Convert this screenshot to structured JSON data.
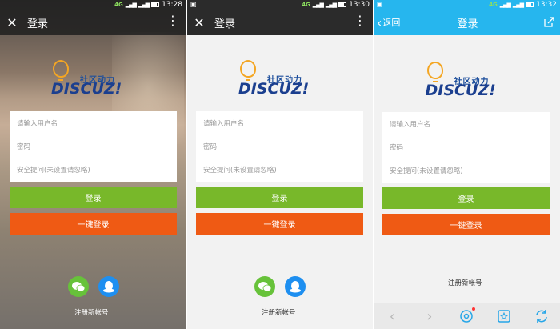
{
  "screens": [
    {
      "status_time": "13:28",
      "header_title": "登录",
      "placeholders": [
        "请输入用户名",
        "密码",
        "安全提问(未设置请忽略)"
      ],
      "login_label": "登录",
      "quick_login_label": "一键登录",
      "register_label": "注册新帐号",
      "network": "4G"
    },
    {
      "status_time": "13:30",
      "header_title": "登录",
      "placeholders": [
        "请输入用户名",
        "密码",
        "安全提问(未设置请忽略)"
      ],
      "login_label": "登录",
      "quick_login_label": "一键登录",
      "register_label": "注册新帐号",
      "network": "4G"
    },
    {
      "status_time": "13:32",
      "header_title": "登录",
      "back_label": "返回",
      "placeholders": [
        "请输入用户名",
        "密码",
        "安全提问(未设置请忽略)"
      ],
      "login_label": "登录",
      "quick_login_label": "一键登录",
      "register_label": "注册新帐号",
      "network": "4G"
    }
  ],
  "logo": {
    "cn": "社区动力",
    "en": "DISCUZ!"
  },
  "colors": {
    "green": "#78b82a",
    "orange": "#ef5a14",
    "blue": "#26b6ee",
    "logo_blue": "#1b3f8f",
    "bulb": "#f4a623"
  }
}
